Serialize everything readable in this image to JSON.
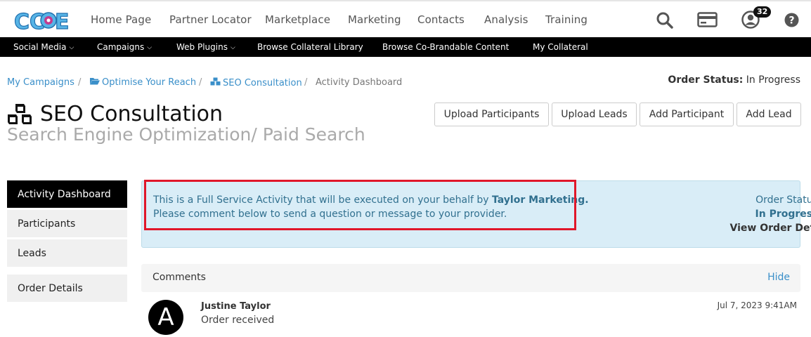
{
  "brand": {
    "logo_text": "CCOE"
  },
  "nav": {
    "items": [
      {
        "label": "Home Page"
      },
      {
        "label": "Partner Locator"
      },
      {
        "label": "Marketplace"
      },
      {
        "label": "Marketing"
      },
      {
        "label": "Contacts"
      },
      {
        "label": "Analysis"
      },
      {
        "label": "Training"
      }
    ],
    "notification_count": "32",
    "icons": [
      "search-icon",
      "credit-card-icon",
      "user-icon",
      "help-icon"
    ]
  },
  "subnav": {
    "items": [
      {
        "label": "Social Media",
        "dropdown": true
      },
      {
        "label": "Campaigns",
        "dropdown": true
      },
      {
        "label": "Web Plugins",
        "dropdown": true
      },
      {
        "label": "Browse Collateral Library",
        "dropdown": false
      },
      {
        "label": "Browse Co-Brandable Content",
        "dropdown": false
      },
      {
        "label": "My Collateral",
        "dropdown": false
      }
    ]
  },
  "breadcrumb": {
    "items": [
      {
        "label": "My Campaigns"
      },
      {
        "label": "Optimise Your Reach"
      },
      {
        "label": "SEO Consultation"
      }
    ],
    "current": "Activity Dashboard"
  },
  "order_status_top": {
    "label": "Order Status:",
    "value": "In Progress"
  },
  "page": {
    "title": "SEO Consultation",
    "subtitle": "Search Engine Optimization/ Paid Search"
  },
  "actions": {
    "upload_participants": "Upload Participants",
    "upload_leads": "Upload Leads",
    "add_participant": "Add Participant",
    "add_lead": "Add Lead"
  },
  "sidebar": {
    "items": [
      {
        "label": "Activity Dashboard",
        "active": true
      },
      {
        "label": "Participants",
        "active": false
      },
      {
        "label": "Leads",
        "active": false
      },
      {
        "label": "Order Details",
        "active": false
      }
    ]
  },
  "info": {
    "line1_prefix": "This is a Full Service Activity that will be executed on your behalf by ",
    "provider": "Taylor Marketing.",
    "line2": "Please comment below to send a question or message to your provider.",
    "status_label": "Order Status",
    "status_value": "In Progress",
    "details_link": "View Order Details »"
  },
  "comments": {
    "title": "Comments",
    "toggle": "Hide",
    "items": [
      {
        "avatar": "A",
        "author": "Justine Taylor",
        "text": "Order received",
        "time": "Jul 7, 2023 9:41AM"
      }
    ]
  },
  "colors": {
    "accent": "#3a8fc9",
    "info_bg": "#d9edf7",
    "highlight": "#e0172a"
  }
}
